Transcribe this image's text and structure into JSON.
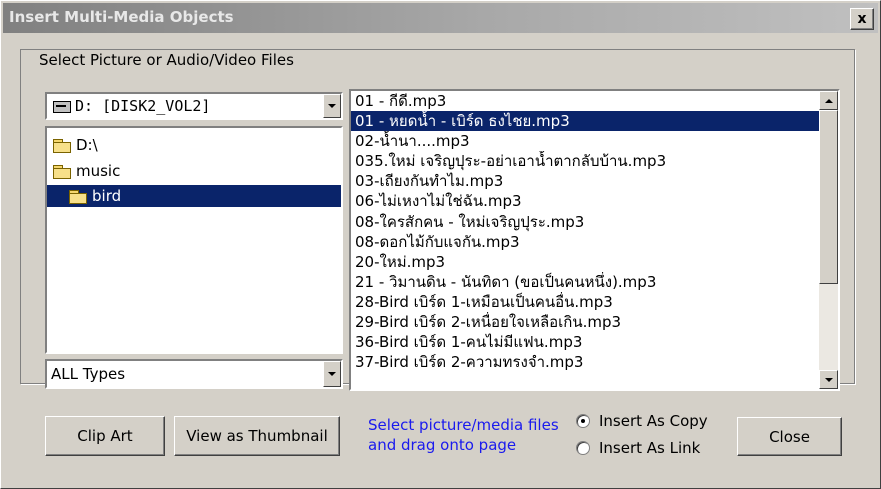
{
  "window": {
    "title": "Insert Multi-Media Objects",
    "close_label": "x"
  },
  "group": {
    "label": "Select Picture or Audio/Video Files"
  },
  "drive_select": {
    "value": "D: [DISK2_VOL2]"
  },
  "folders": [
    {
      "label": "D:\\",
      "selected": false
    },
    {
      "label": "music",
      "selected": false
    },
    {
      "label": "bird",
      "selected": true
    }
  ],
  "file_type_select": {
    "value": "ALL Types"
  },
  "files": [
    "01 - กีดี.mp3",
    "01 - หยดน้ำ - เบิร์ด ธงไชย.mp3",
    "02-น้ำนา....mp3",
    "035.ใหม่ เจริญปุระ-อย่าเอาน้ำตากลับบ้าน.mp3",
    "03-เถียงกันทำไม.mp3",
    "06-ไม่เหงาไม่ใช่ฉัน.mp3",
    "08-ใครสักคน - ใหม่เจริญปุระ.mp3",
    "08-ดอกไม้กับแจกัน.mp3",
    "20-ใหม่.mp3",
    "21 - วิมานดิน - นันทิดา (ขอเป็นคนหนึ่ง).mp3",
    "28-Bird เบิร์ด 1-เหมือนเป็นคนอื่น.mp3",
    "29-Bird เบิร์ด 2-เหนื่อยใจเหลือเกิน.mp3",
    "36-Bird เบิร์ด 1-คนไม่มีแฟน.mp3",
    "37-Bird เบิร์ด 2-ความทรงจำ.mp3"
  ],
  "selected_file_index": 1,
  "buttons": {
    "clip_art": "Clip Art",
    "view_thumbnail": "View as Thumbnail",
    "close": "Close"
  },
  "hint": {
    "line1": "Select picture/media files",
    "line2": "and drag onto page"
  },
  "insert_mode": {
    "copy_label": "Insert As Copy",
    "link_label": "Insert As Link",
    "selected": "copy"
  },
  "colors": {
    "selection": "#0a246a",
    "hint_text": "#1a1aee",
    "face": "#d4d0c8"
  }
}
